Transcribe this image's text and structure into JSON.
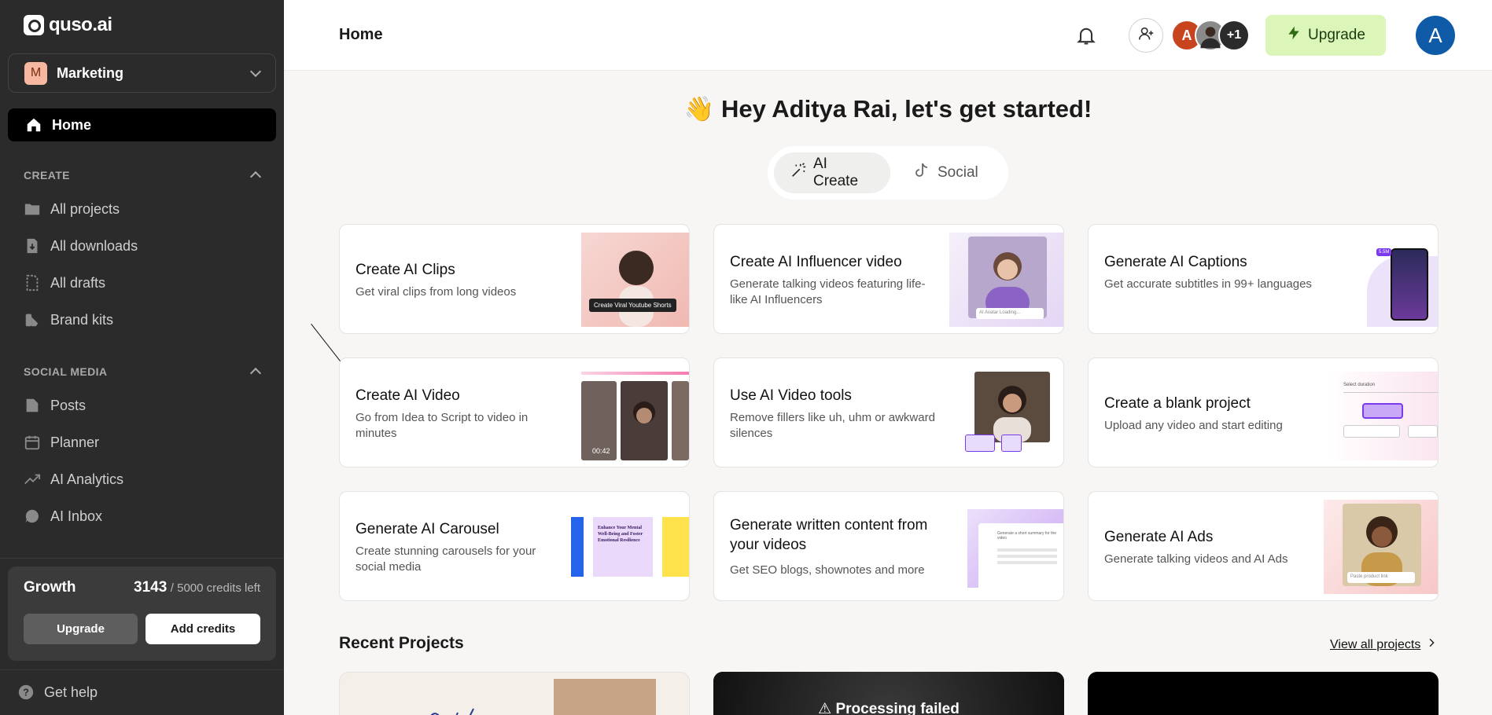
{
  "sidebar": {
    "logo": "quso.ai",
    "workspace": {
      "initial": "M",
      "name": "Marketing"
    },
    "home": "Home",
    "create_section": "CREATE",
    "create_items": [
      {
        "label": "All projects",
        "icon": "folder-icon"
      },
      {
        "label": "All downloads",
        "icon": "download-file-icon"
      },
      {
        "label": "All drafts",
        "icon": "draft-icon"
      },
      {
        "label": "Brand kits",
        "icon": "brand-kit-icon"
      }
    ],
    "social_section": "SOCIAL MEDIA",
    "social_items": [
      {
        "label": "Posts",
        "icon": "posts-icon"
      },
      {
        "label": "Planner",
        "icon": "calendar-icon"
      },
      {
        "label": "AI Analytics",
        "icon": "analytics-icon"
      },
      {
        "label": "AI Inbox",
        "icon": "chat-icon"
      }
    ],
    "credits": {
      "plan": "Growth",
      "used": "3143",
      "rest": "/ 5000 credits left",
      "upgrade": "Upgrade",
      "add": "Add credits"
    },
    "help": "Get help"
  },
  "topbar": {
    "title": "Home",
    "avatars": [
      {
        "initial": "A",
        "color": "#c8441f"
      },
      {
        "initial": "",
        "color": "#7f7f7f"
      },
      {
        "initial": "+1",
        "color": "#2b2b2b"
      }
    ],
    "upgrade": "Upgrade",
    "me": "A"
  },
  "main": {
    "greeting": "Hey Aditya Rai, let's get started!",
    "greeting_emoji": "👋",
    "tabs": [
      {
        "label": "AI Create"
      },
      {
        "label": "Social"
      }
    ],
    "cards": [
      {
        "title": "Create AI Clips",
        "desc": "Get viral clips from long videos",
        "thumb_caption": "Create Viral Youtube Shorts"
      },
      {
        "title": "Create AI Influencer video",
        "desc": "Generate talking videos featuring life-like AI Influencers",
        "thumb_caption": "AI Avatar Loading..."
      },
      {
        "title": "Generate AI Captions",
        "desc": "Get accurate subtitles in 99+ languages",
        "thumb_caption": "5.5M"
      },
      {
        "title": "Create AI Video",
        "desc": "Go from Idea to Script to video in minutes",
        "thumb_caption": "00:42"
      },
      {
        "title": "Use AI Video tools",
        "desc": "Remove fillers like uh, uhm or awkward silences",
        "thumb_caption": ""
      },
      {
        "title": "Create a blank project",
        "desc": "Upload any video and start editing",
        "thumb_caption": "Select duration"
      },
      {
        "title": "Generate AI Carousel",
        "desc": "Create stunning carousels for your social media",
        "thumb_caption": "Enhance Your Mental Well-Being and Foster Emotional Resilience"
      },
      {
        "title": "Generate written content from your videos",
        "desc": "Get SEO blogs, shownotes and more",
        "thumb_caption": "Generate a short summary for the video"
      },
      {
        "title": "Generate AI Ads",
        "desc": "Generate talking videos and AI Ads",
        "thumb_caption": "Paste product link"
      }
    ],
    "recent_title": "Recent Projects",
    "view_all": "View all projects",
    "recent_fail": "Processing failed"
  }
}
